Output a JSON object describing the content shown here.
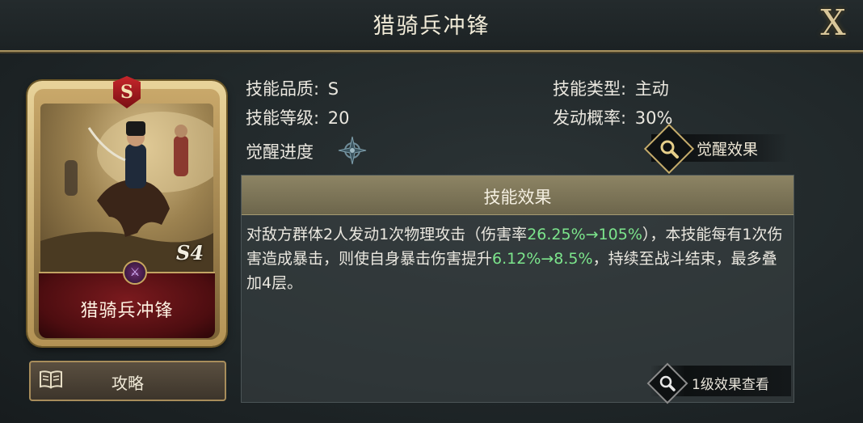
{
  "window": {
    "title": "猎骑兵冲锋",
    "close_label": "X"
  },
  "card": {
    "name": "猎骑兵冲锋",
    "grade": "S",
    "season_mark": "S4",
    "type_icon": "swords-icon"
  },
  "guide_button": {
    "label": "攻略",
    "icon": "book-icon"
  },
  "skill_info": {
    "quality_label": "技能品质:",
    "quality_value": "S",
    "type_label": "技能类型:",
    "type_value": "主动",
    "level_label": "技能等级:",
    "level_value": "20",
    "rate_label": "发动概率:",
    "rate_value": "30%",
    "awaken_label": "觉醒进度"
  },
  "awaken_button": {
    "label": "觉醒效果"
  },
  "effect": {
    "title": "技能效果",
    "text_1": "对敌方群体2人发动1次物理攻击（伤害率",
    "hl_1": "26.25%→105%",
    "text_2": "），本技能每有1次伤害造成暴击，则使自身暴击伤害提升",
    "hl_2": "6.12%→8.5%",
    "text_3": "，持续至战斗结束，最多叠加4层。"
  },
  "level_button": {
    "label": "1级效果查看"
  },
  "colors": {
    "highlight": "#7ce58c",
    "gold_border": "#a8925f",
    "header_bar": "#8d8464"
  }
}
